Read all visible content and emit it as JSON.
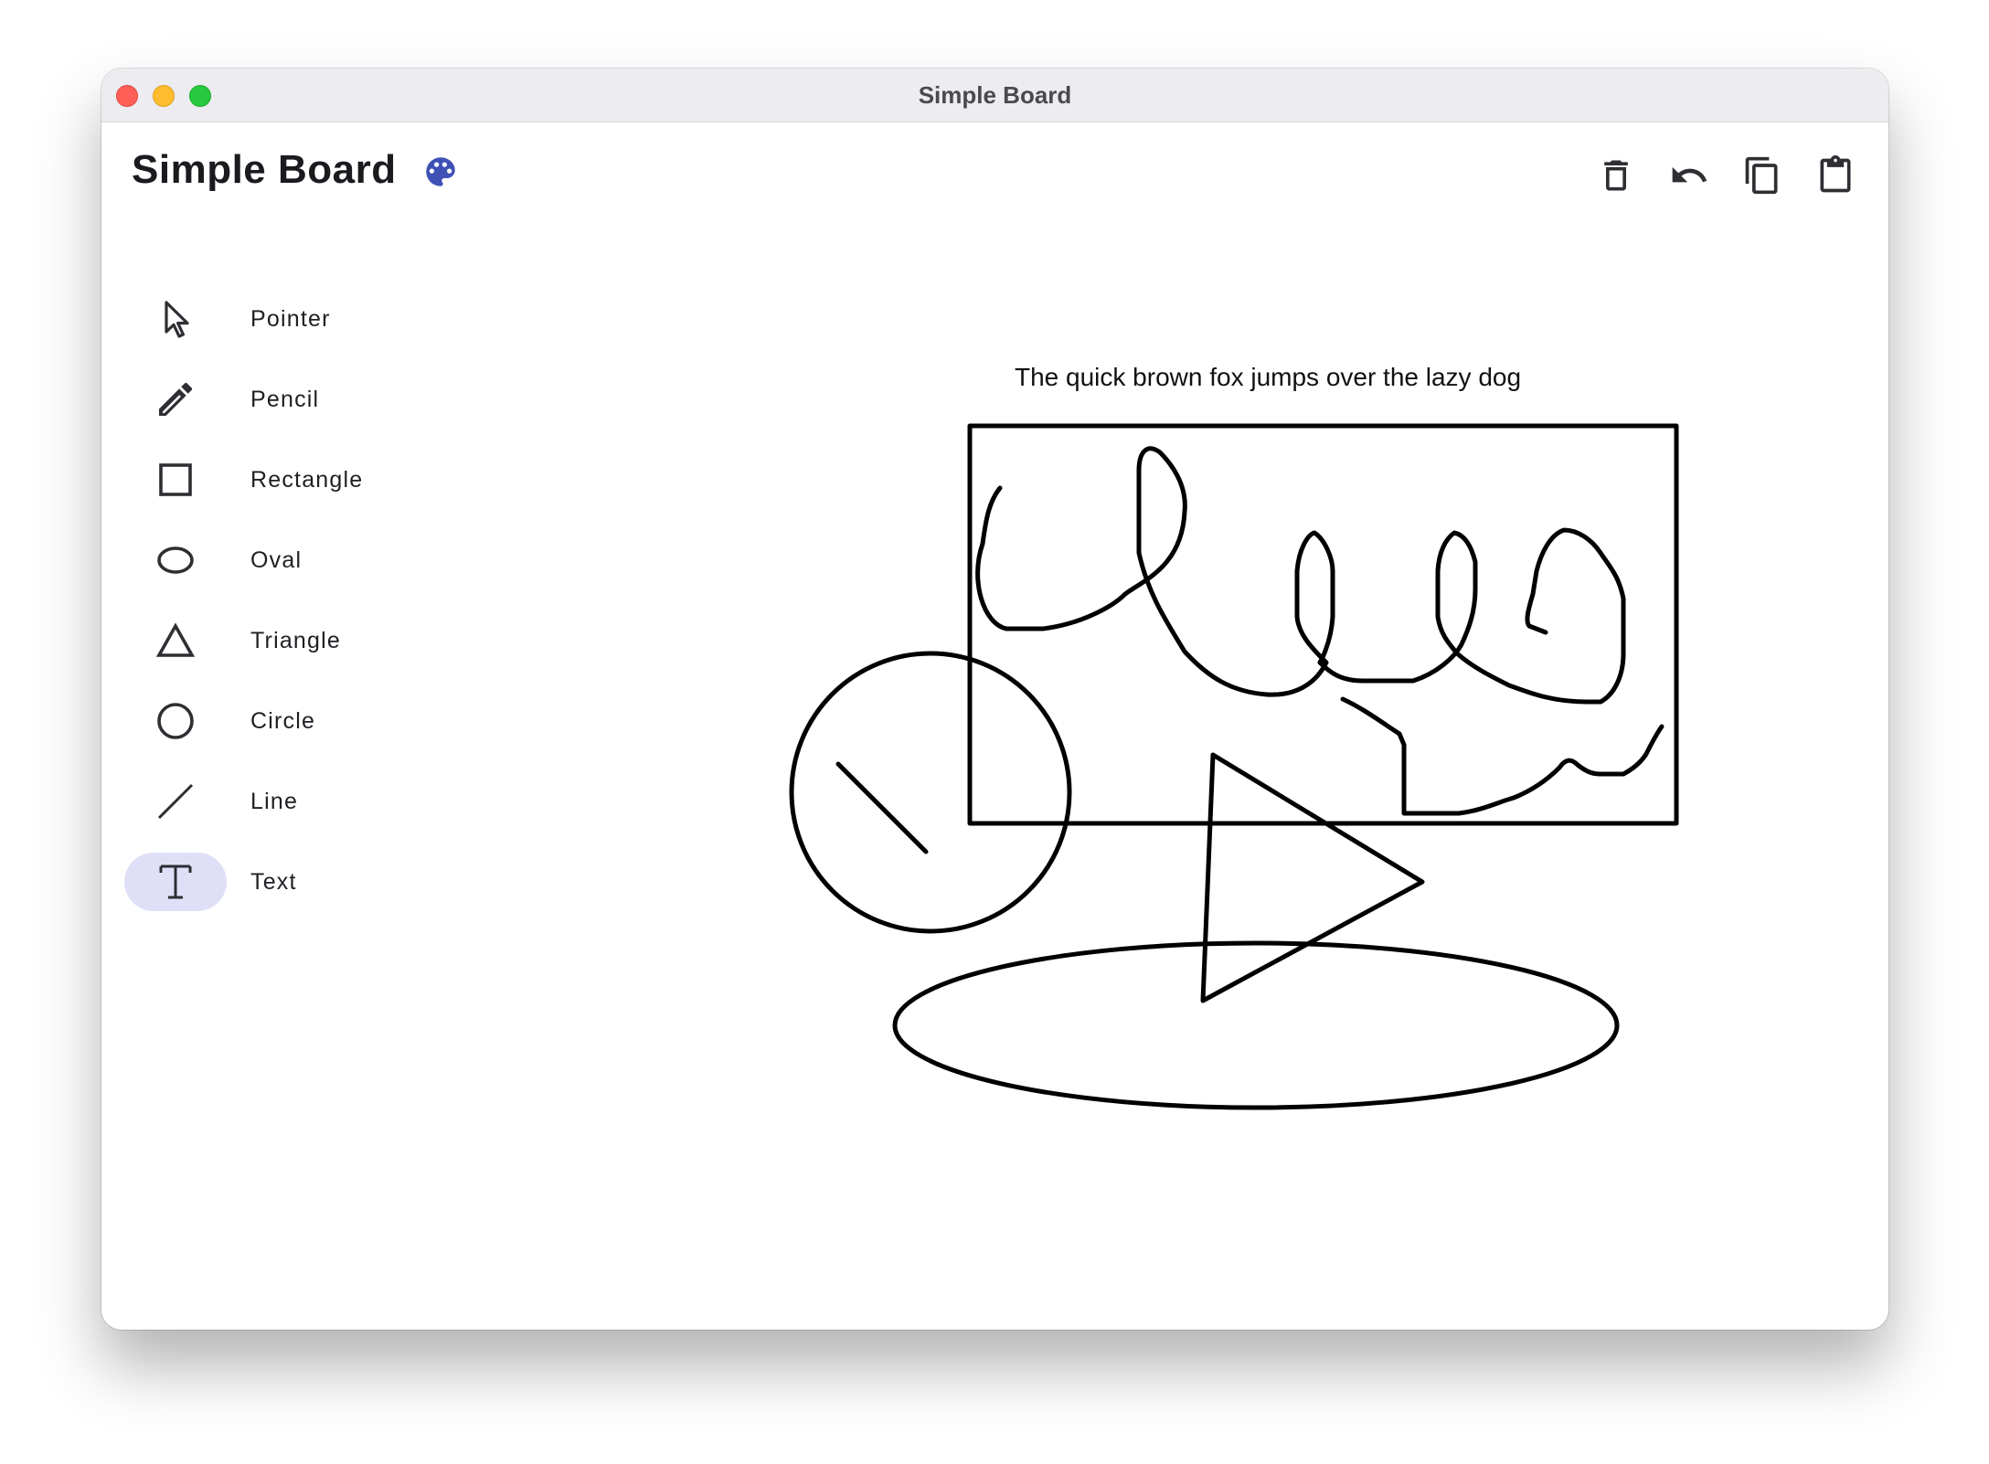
{
  "window": {
    "title": "Simple Board"
  },
  "header": {
    "title": "Simple Board",
    "palette_icon": "palette-icon",
    "palette_color": "#3f51b5"
  },
  "actions": [
    {
      "name": "delete",
      "icon": "trash-icon"
    },
    {
      "name": "undo",
      "icon": "undo-icon"
    },
    {
      "name": "copy",
      "icon": "copy-icon"
    },
    {
      "name": "paste",
      "icon": "clipboard-icon"
    }
  ],
  "tools": [
    {
      "label": "Pointer",
      "icon": "pointer-icon",
      "selected": false
    },
    {
      "label": "Pencil",
      "icon": "pencil-icon",
      "selected": false
    },
    {
      "label": "Rectangle",
      "icon": "rectangle-icon",
      "selected": false
    },
    {
      "label": "Oval",
      "icon": "oval-icon",
      "selected": false
    },
    {
      "label": "Triangle",
      "icon": "triangle-icon",
      "selected": false
    },
    {
      "label": "Circle",
      "icon": "circle-icon",
      "selected": false
    },
    {
      "label": "Line",
      "icon": "line-icon",
      "selected": false
    },
    {
      "label": "Text",
      "icon": "text-icon",
      "selected": true
    }
  ],
  "canvas": {
    "text": "The quick brown fox jumps over the lazy dog",
    "selection_color": "#dfe0f8",
    "stroke_color": "#000000"
  }
}
